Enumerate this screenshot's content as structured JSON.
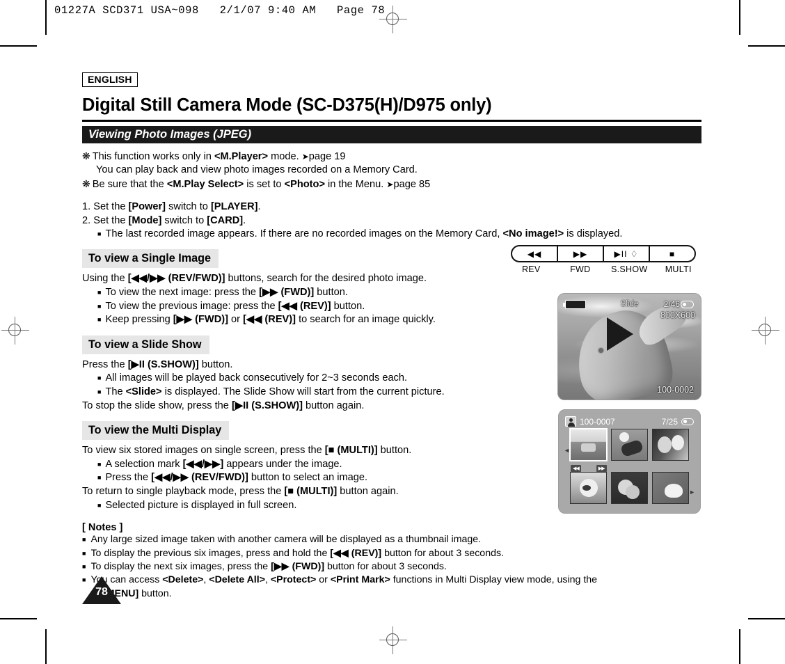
{
  "print_header": "01227A SCD371 USA~098   2/1/07 9:40 AM   Page 78",
  "language_badge": "ENGLISH",
  "doc_title": "Digital Still Camera Mode (SC-D375(H)/D975 only)",
  "section_bar": "Viewing Photo Images (JPEG)",
  "intro": {
    "line1_a": "This function works only in ",
    "line1_b": "<M.Player>",
    "line1_c": " mode. ",
    "line1_ref": "page 19",
    "line2": "You can play back and view photo images recorded on a Memory Card.",
    "line3_a": "Be sure that the ",
    "line3_b": "<M.Play Select>",
    "line3_c": " is set to ",
    "line3_d": "<Photo>",
    "line3_e": " in the Menu. ",
    "line3_ref": "page 85"
  },
  "steps": {
    "s1_a": "1. Set the ",
    "s1_b": "[Power]",
    "s1_c": " switch to ",
    "s1_d": "[PLAYER]",
    "s1_e": ".",
    "s2_a": "2. Set the ",
    "s2_b": "[Mode]",
    "s2_c": " switch to ",
    "s2_d": "[CARD]",
    "s2_e": ".",
    "s2_bullet_a": "The last recorded image appears. If there are no recorded images on the Memory Card, ",
    "s2_bullet_b": "<No image!>",
    "s2_bullet_c": " is displayed."
  },
  "single": {
    "heading": "To view a Single Image",
    "lead_a": "Using the ",
    "lead_b": "[◀◀/▶▶ (REV/FWD)]",
    "lead_c": " buttons, search for the desired photo image.",
    "b1_a": "To view the next image: press the ",
    "b1_b": "[▶▶ (FWD)]",
    "b1_c": " button.",
    "b2_a": "To view the previous image: press the ",
    "b2_b": "[◀◀ (REV)]",
    "b2_c": " button.",
    "b3_a": "Keep pressing ",
    "b3_b": "[▶▶ (FWD)]",
    "b3_c": " or ",
    "b3_d": "[◀◀ (REV)]",
    "b3_e": " to search for an image quickly."
  },
  "slideshow": {
    "heading": "To view a Slide Show",
    "lead_a": "Press the ",
    "lead_b": "[▶II (S.SHOW)]",
    "lead_c": " button.",
    "b1": "All images will be played back consecutively for 2~3 seconds each.",
    "b2_a": "The ",
    "b2_b": "<Slide>",
    "b2_c": " is displayed. The Slide Show will start from the current picture.",
    "tail_a": "To stop the slide show, press the ",
    "tail_b": "[▶II (S.SHOW)]",
    "tail_c": " button again."
  },
  "multi": {
    "heading": "To view the Multi Display",
    "lead_a": "To view six stored images on single screen, press the ",
    "lead_b": "[■ (MULTI)]",
    "lead_c": " button.",
    "b1_a": "A selection mark ",
    "b1_b": "[◀◀/▶▶]",
    "b1_c": " appears under the image.",
    "b2_a": "Press the ",
    "b2_b": "[◀◀/▶▶ (REV/FWD)]",
    "b2_c": " button to select an image.",
    "tail_a": "To return to single playback mode, press the ",
    "tail_b": "[■ (MULTI)]",
    "tail_c": " button again.",
    "b3": "Selected picture is displayed in full screen."
  },
  "notes": {
    "title": "[ Notes ]",
    "n1": "Any large sized image taken with another camera will be displayed as a thumbnail image.",
    "n2_a": "To display the previous six images, press and hold the ",
    "n2_b": "[◀◀ (REV)]",
    "n2_c": " button for about 3 seconds.",
    "n3_a": "To display the next six images, press the ",
    "n3_b": "[▶▶ (FWD)]",
    "n3_c": " button for about 3 seconds.",
    "n4_a": "You can access ",
    "n4_b": "<Delete>",
    "n4_c": ", ",
    "n4_d": "<Delete All>",
    "n4_e": ", ",
    "n4_f": "<Protect>",
    "n4_g": " or ",
    "n4_h": "<Print Mark>",
    "n4_i": " functions in Multi Display view mode, using the",
    "n4_j": "[Q.MENU]",
    "n4_k": " button."
  },
  "page_number": "78",
  "button_panel": {
    "keys": [
      {
        "glyph": "◀◀",
        "label": "REV"
      },
      {
        "glyph": "▶▶",
        "label": "FWD"
      },
      {
        "glyph": "▶II ♢",
        "label": "S.SHOW"
      },
      {
        "glyph": "■",
        "label": "MULTI"
      }
    ]
  },
  "lcd_single": {
    "mode_text": "Slide",
    "counter": "2/46",
    "resolution": "800X600",
    "file_name": "100-0002",
    "subject": "dolphin"
  },
  "lcd_multi": {
    "file_name": "100-0007",
    "counter": "7/25",
    "rev_mark": "◀◀",
    "fwd_mark": "▶▶",
    "thumbnails": [
      {
        "name": "landscape",
        "selected": true
      },
      {
        "name": "soccer",
        "selected": false
      },
      {
        "name": "mother-and-child",
        "selected": false
      },
      {
        "name": "dog",
        "selected": false
      },
      {
        "name": "cosmos-flowers",
        "selected": false
      },
      {
        "name": "lotus-flower",
        "selected": false
      }
    ]
  },
  "colors": {
    "bar": "#1a1a1a",
    "section_head_bg": "#e6e6e6"
  }
}
